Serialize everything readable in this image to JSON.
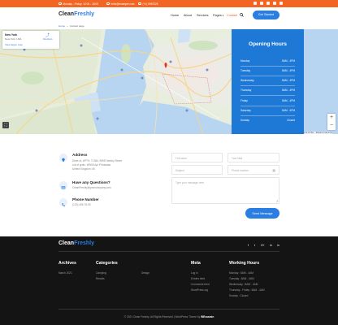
{
  "topbar": {
    "hours": "Monday - Friday: 10:00 - 18:00",
    "email": "hello@example.com",
    "phone": "(+1) 0987325",
    "social_icons": [
      "facebook-icon",
      "instagram-icon",
      "twitter-icon",
      "vimeo-icon",
      "pinterest-icon"
    ]
  },
  "header": {
    "logo_main": "Clean",
    "logo_accent": "Freshly",
    "nav": [
      "Home",
      "About",
      "Services",
      "Pages",
      "Contact"
    ],
    "nav_active": "Contact",
    "quote_button": "Get Started"
  },
  "breadcrumb": {
    "home": "Home",
    "current": "Contact page"
  },
  "map": {
    "card_title": "New York",
    "card_sub": "New York, USA",
    "card_link": "View larger map",
    "directions": "Directions",
    "footer_links": [
      "Terms of Use",
      "Report a map error"
    ],
    "zoom_in": "+",
    "zoom_out": "−"
  },
  "opening_hours": {
    "title": "Opening Hours",
    "rows": [
      {
        "day": "Monday",
        "time": "8AM - 4PM"
      },
      {
        "day": "Tuesday",
        "time": "8AM - 4PM"
      },
      {
        "day": "Wednesday",
        "time": "8AM - 4PM"
      },
      {
        "day": "Thursday",
        "time": "8AM - 4PM"
      },
      {
        "day": "Friday",
        "time": "8AM - 4PM"
      },
      {
        "day": "Saturday",
        "time": "8AM - 4PM"
      },
      {
        "day": "Sunday",
        "time": "Closed"
      }
    ]
  },
  "contact": {
    "address_title": "Address",
    "address_lines": [
      "Dinet rd, APTH, T1NM, 9895 Hereby Street",
      "out of grain, #9506 Apt Privatatas",
      "United Kingdom UK"
    ],
    "questions_title": "Have any Questions?",
    "questions_email": "CleanFreshly@yourcompany.com",
    "phone_title": "Phone Number",
    "phone_value": "(123) 456 78-90"
  },
  "form": {
    "full_name": "Full name",
    "your_mail": "Your Mail",
    "subject": "Subject",
    "phone": "Phone number",
    "message": "Type your message here",
    "send": "Send Message"
  },
  "footer": {
    "logo_main": "Clean",
    "logo_accent": "Freshly",
    "social": [
      "f",
      "t",
      "G+",
      "in",
      "in"
    ],
    "archives_title": "Archives",
    "archives": [
      "March 2021"
    ],
    "categories_title": "Categories",
    "categories_col1": [
      "Camping",
      "Results"
    ],
    "categories_col2": [
      "Design"
    ],
    "meta_title": "Meta",
    "meta": [
      "Log in",
      "Entries feed",
      "Comments feed",
      "WordPress.org"
    ],
    "hours_title": "Working Hours",
    "hours": [
      "Monday : 8AM - 4AM",
      "Tuesday : 8AM - 4AM",
      "Wednesday : 8AM - 4AM",
      "Thursday - Friday : 8AM - 4AM",
      "Sunday : Closed"
    ],
    "copyright_pre": "© 2021 Clean Freshly. All Rights Reserved | WordPress Theme by",
    "copyright_brand": "WEcasmin"
  }
}
